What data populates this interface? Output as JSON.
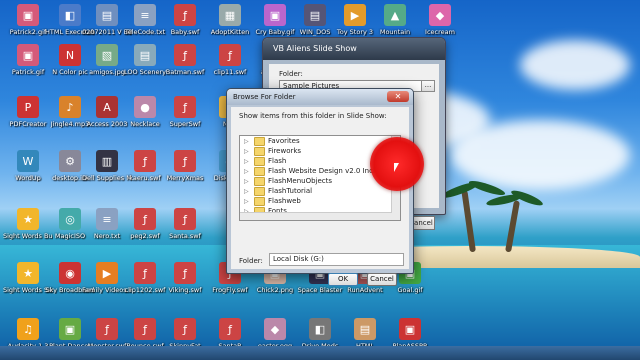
{
  "desktop": {
    "icons": [
      {
        "label": "Patrick2.gif",
        "glyph": "▣",
        "color": "#d45a7a"
      },
      {
        "label": "HTML Executab",
        "glyph": "◧",
        "color": "#4b7bc9"
      },
      {
        "label": "02072011 V BBExch",
        "glyph": "▤",
        "color": "#6f8fbf"
      },
      {
        "label": "TeleCode.txt",
        "glyph": "≡",
        "color": "#8aa1c2"
      },
      {
        "label": "Baby.swf",
        "glyph": "ƒ",
        "color": "#c44"
      },
      {
        "label": "AdoptKitten",
        "glyph": "▦",
        "color": "#9aa"
      },
      {
        "label": "Cry Baby.gif",
        "glyph": "▣",
        "color": "#b6c"
      },
      {
        "label": "WIN_DOS",
        "glyph": "▤",
        "color": "#557"
      },
      {
        "label": "Toy Story 3",
        "glyph": "▶",
        "color": "#e39b2b"
      },
      {
        "label": "Mountain",
        "glyph": "▲",
        "color": "#5a8"
      },
      {
        "label": "Icecream",
        "glyph": "◆",
        "color": "#d6a"
      },
      {
        "label": "Patrick.gif",
        "glyph": "▣",
        "color": "#d45a7a"
      },
      {
        "label": "N Color pic",
        "glyph": "N",
        "color": "#c33"
      },
      {
        "label": "amigos.jpg",
        "glyph": "▧",
        "color": "#7a8"
      },
      {
        "label": "LOO Scenery",
        "glyph": "▤",
        "color": "#8ab"
      },
      {
        "label": "Batman.swf",
        "glyph": "ƒ",
        "color": "#c44"
      },
      {
        "label": "clip11.swf",
        "glyph": "ƒ",
        "color": "#c44"
      },
      {
        "label": "alien.swf",
        "glyph": "ƒ",
        "color": "#c44"
      },
      {
        "label": "PDFCreator",
        "glyph": "P",
        "color": "#c33"
      },
      {
        "label": "Jingle4.mp3",
        "glyph": "♪",
        "color": "#d9822b"
      },
      {
        "label": "Access 2003",
        "glyph": "A",
        "color": "#a33"
      },
      {
        "label": "Necklace",
        "glyph": "●",
        "color": "#b8a"
      },
      {
        "label": "SuperSwf",
        "glyph": "ƒ",
        "color": "#c44"
      },
      {
        "label": "New",
        "glyph": "✦",
        "color": "#eb4"
      },
      {
        "label": "WordUp",
        "glyph": "W",
        "color": "#38b"
      },
      {
        "label": "desktop.ini",
        "glyph": "⚙",
        "color": "#889"
      },
      {
        "label": "Dell Supplies Manageme",
        "glyph": "▥",
        "color": "#334"
      },
      {
        "label": "kaeru.swf",
        "glyph": "ƒ",
        "color": "#c44"
      },
      {
        "label": "MerryXmas",
        "glyph": "ƒ",
        "color": "#c44"
      },
      {
        "label": "Diskeeper",
        "glyph": "◉",
        "color": "#49c"
      },
      {
        "label": "Sight Words Buddy",
        "glyph": "★",
        "color": "#f2b62b"
      },
      {
        "label": "MagicISO",
        "glyph": "◎",
        "color": "#4aa"
      },
      {
        "label": "Nero.txt",
        "glyph": "≡",
        "color": "#8aa1c2"
      },
      {
        "label": "peg2.swf",
        "glyph": "ƒ",
        "color": "#c44"
      },
      {
        "label": "Santa.swf",
        "glyph": "ƒ",
        "color": "#c44"
      },
      {
        "label": "Sight Words Sentence",
        "glyph": "★",
        "color": "#f2b62b"
      },
      {
        "label": "Sky Broadband",
        "glyph": "◉",
        "color": "#c33"
      },
      {
        "label": "Family Videos.mswmm",
        "glyph": "▶",
        "color": "#e67e22"
      },
      {
        "label": "clip1202.swf",
        "glyph": "ƒ",
        "color": "#c44"
      },
      {
        "label": "Viking.swf",
        "glyph": "ƒ",
        "color": "#c44"
      },
      {
        "label": "FrogFly.swf",
        "glyph": "ƒ",
        "color": "#c44"
      },
      {
        "label": "Chick2.png",
        "glyph": "▣",
        "color": "#dba"
      },
      {
        "label": "Space Blaster",
        "glyph": "▣",
        "color": "#335"
      },
      {
        "label": "RunAdvent",
        "glyph": "▣",
        "color": "#a55"
      },
      {
        "label": "Goal.gif",
        "glyph": "▣",
        "color": "#4a4"
      },
      {
        "label": "Audacity 1.3",
        "glyph": "♫",
        "color": "#f0a11b"
      },
      {
        "label": "Plant Dancer",
        "glyph": "▣",
        "color": "#6a4"
      },
      {
        "label": "Monster.swf",
        "glyph": "ƒ",
        "color": "#c44"
      },
      {
        "label": "Bounce.swf",
        "glyph": "ƒ",
        "color": "#c44"
      },
      {
        "label": "SkinnyFat",
        "glyph": "ƒ",
        "color": "#c44"
      },
      {
        "label": "SantaR",
        "glyph": "ƒ",
        "color": "#c44"
      },
      {
        "label": "easter.egg",
        "glyph": "◆",
        "color": "#b8a"
      },
      {
        "label": "Drive Mods",
        "glyph": "◧",
        "color": "#777"
      },
      {
        "label": "HTML",
        "glyph": "▤",
        "color": "#c96"
      },
      {
        "label": "PlanASSPR",
        "glyph": "▣",
        "color": "#c33"
      }
    ]
  },
  "backWindow": {
    "title": "VB Aliens Slide Show",
    "folder_label": "Folder:",
    "folder_value": "Sample Pictures",
    "browse_label": "...",
    "cancel_label": "Cancel"
  },
  "dialog": {
    "title": "Browse For Folder",
    "close_label": "✕",
    "prompt": "Show items from this folder in Slide Show:",
    "tree": [
      {
        "label": "Favorites"
      },
      {
        "label": "Fireworks"
      },
      {
        "label": "Flash"
      },
      {
        "label": "Flash Website Design v2.0 Incl Patch (Acr"
      },
      {
        "label": "FlashMenuObjects"
      },
      {
        "label": "FlashTutorial"
      },
      {
        "label": "Flashweb"
      },
      {
        "label": "Fonts"
      }
    ],
    "folder_label": "Folder:",
    "folder_value": "Local Disk (G:)",
    "ok_label": "OK",
    "cancel_label": "Cancel"
  }
}
